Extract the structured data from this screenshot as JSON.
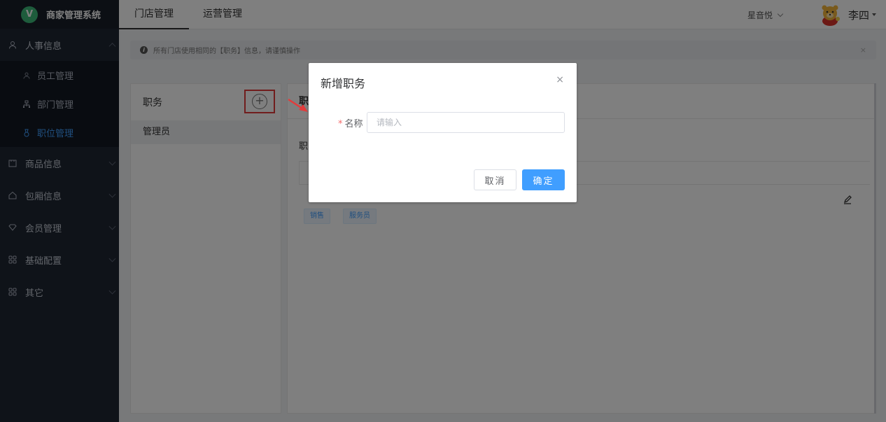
{
  "app": {
    "logo_letter": "V",
    "name": "商家管理系统",
    "brand_color": "#3cb878"
  },
  "sidebar": {
    "items": [
      {
        "label": "人事信息",
        "icon": "user-icon",
        "expanded": true,
        "children": [
          {
            "label": "员工管理",
            "icon": "staff-icon",
            "active": false
          },
          {
            "label": "部门管理",
            "icon": "department-icon",
            "active": false
          },
          {
            "label": "职位管理",
            "icon": "position-icon",
            "active": true
          }
        ]
      },
      {
        "label": "商品信息",
        "icon": "goods-icon"
      },
      {
        "label": "包厢信息",
        "icon": "room-icon"
      },
      {
        "label": "会员管理",
        "icon": "member-icon"
      },
      {
        "label": "基础配置",
        "icon": "grid-icon"
      },
      {
        "label": "其它",
        "icon": "grid-icon"
      }
    ]
  },
  "topbar": {
    "tabs": [
      {
        "label": "门店管理",
        "active": true
      },
      {
        "label": "运营管理",
        "active": false
      }
    ],
    "store_selector": "星音悦",
    "user_name": "李四"
  },
  "alert": {
    "text": "所有门店使用相同的【职务】信息，请谨慎操作",
    "close": "×"
  },
  "left_panel": {
    "title": "职务",
    "add_symbol": "+",
    "roles": [
      "管理员"
    ]
  },
  "right_panel": {
    "title": "职",
    "subtitle": "职",
    "tags": [
      "销售",
      "服务员"
    ]
  },
  "dialog": {
    "title": "新增职务",
    "close": "×",
    "field_required_mark": "*",
    "field_label": "名称",
    "field_placeholder": "请输入",
    "field_value": "",
    "cancel_label": "取消",
    "confirm_label": "确定"
  },
  "colors": {
    "sidebar_bg": "#1f2633",
    "accent": "#409eff",
    "highlight_border": "#e23b3b"
  }
}
